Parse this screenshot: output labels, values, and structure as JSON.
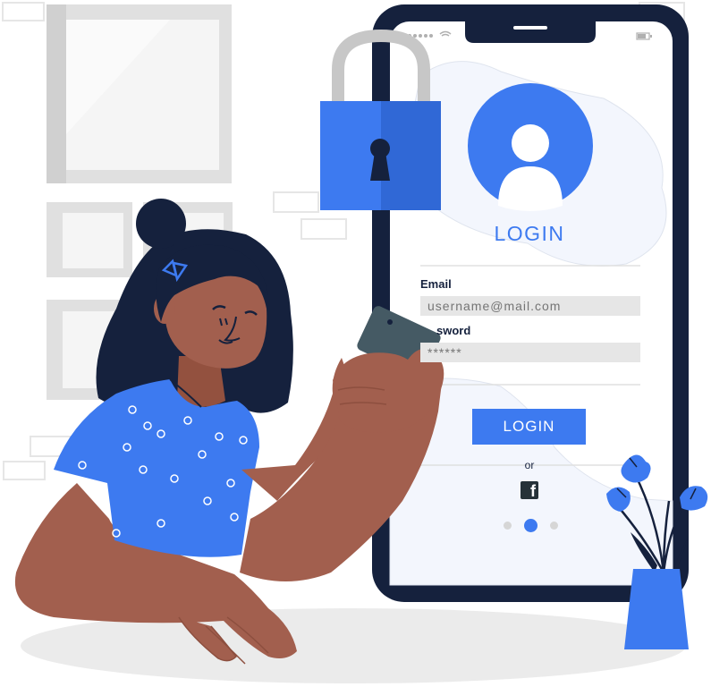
{
  "login_form": {
    "title": "LOGIN",
    "email_label": "Email",
    "email_placeholder": "username@mail.com",
    "password_label": "sword",
    "password_placeholder": "******",
    "login_button": "LOGIN",
    "or_text": "or",
    "facebook_glyph": "f"
  },
  "pagination": {
    "active_index": 1,
    "count": 3
  },
  "colors": {
    "accent_blue": "#3d7af0",
    "navy": "#15213d",
    "skin": "#a25f4e",
    "light_gray": "#e0e0e0",
    "phone_bg": "#f3f6fd"
  },
  "icons": [
    "lock-icon",
    "user-avatar-icon",
    "facebook-icon",
    "signal-icon",
    "wifi-icon",
    "battery-icon"
  ]
}
